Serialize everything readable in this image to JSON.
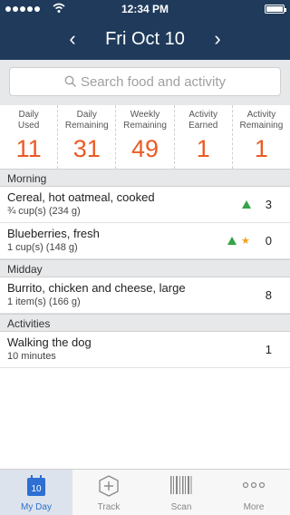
{
  "status_bar": {
    "time": "12:34 PM"
  },
  "header": {
    "date": "Fri Oct 10",
    "prev_arrow": "‹",
    "next_arrow": "›"
  },
  "search": {
    "placeholder": "Search food and activity"
  },
  "stats": [
    {
      "label_line1": "Daily",
      "label_line2": "Used",
      "value": "11"
    },
    {
      "label_line1": "Daily",
      "label_line2": "Remaining",
      "value": "31"
    },
    {
      "label_line1": "Weekly",
      "label_line2": "Remaining",
      "value": "49"
    },
    {
      "label_line1": "Activity",
      "label_line2": "Earned",
      "value": "1"
    },
    {
      "label_line1": "Activity",
      "label_line2": "Remaining",
      "value": "1"
    }
  ],
  "sections": {
    "morning": "Morning",
    "midday": "Midday",
    "activities": "Activities"
  },
  "entries": [
    {
      "name": "Cereal, hot oatmeal, cooked",
      "portion": "¾ cup(s) (234 g)",
      "value": "3",
      "icons": [
        "triangle-icon"
      ]
    },
    {
      "name": "Blueberries, fresh",
      "portion": "1 cup(s) (148 g)",
      "value": "0",
      "icons": [
        "triangle-icon",
        "star-icon"
      ]
    },
    {
      "name": "Burrito, chicken and cheese, large",
      "portion": "1 item(s) (166 g)",
      "value": "8",
      "icons": []
    },
    {
      "name": "Walking the dog",
      "portion": "10 minutes",
      "value": "1",
      "icons": []
    }
  ],
  "tabbar": {
    "tabs": [
      {
        "label": "My Day",
        "icon": "calendar-icon",
        "badge": "10",
        "active": true
      },
      {
        "label": "Track",
        "icon": "plus-circle-icon",
        "active": false
      },
      {
        "label": "Scan",
        "icon": "barcode-icon",
        "active": false
      },
      {
        "label": "More",
        "icon": "more-dots-icon",
        "active": false
      }
    ]
  },
  "colors": {
    "header_bg": "#1f3a5a",
    "accent_orange": "#ea5b24",
    "triangle_green": "#33a346",
    "star_orange": "#f0a020",
    "tab_active": "#2d6fd2"
  }
}
